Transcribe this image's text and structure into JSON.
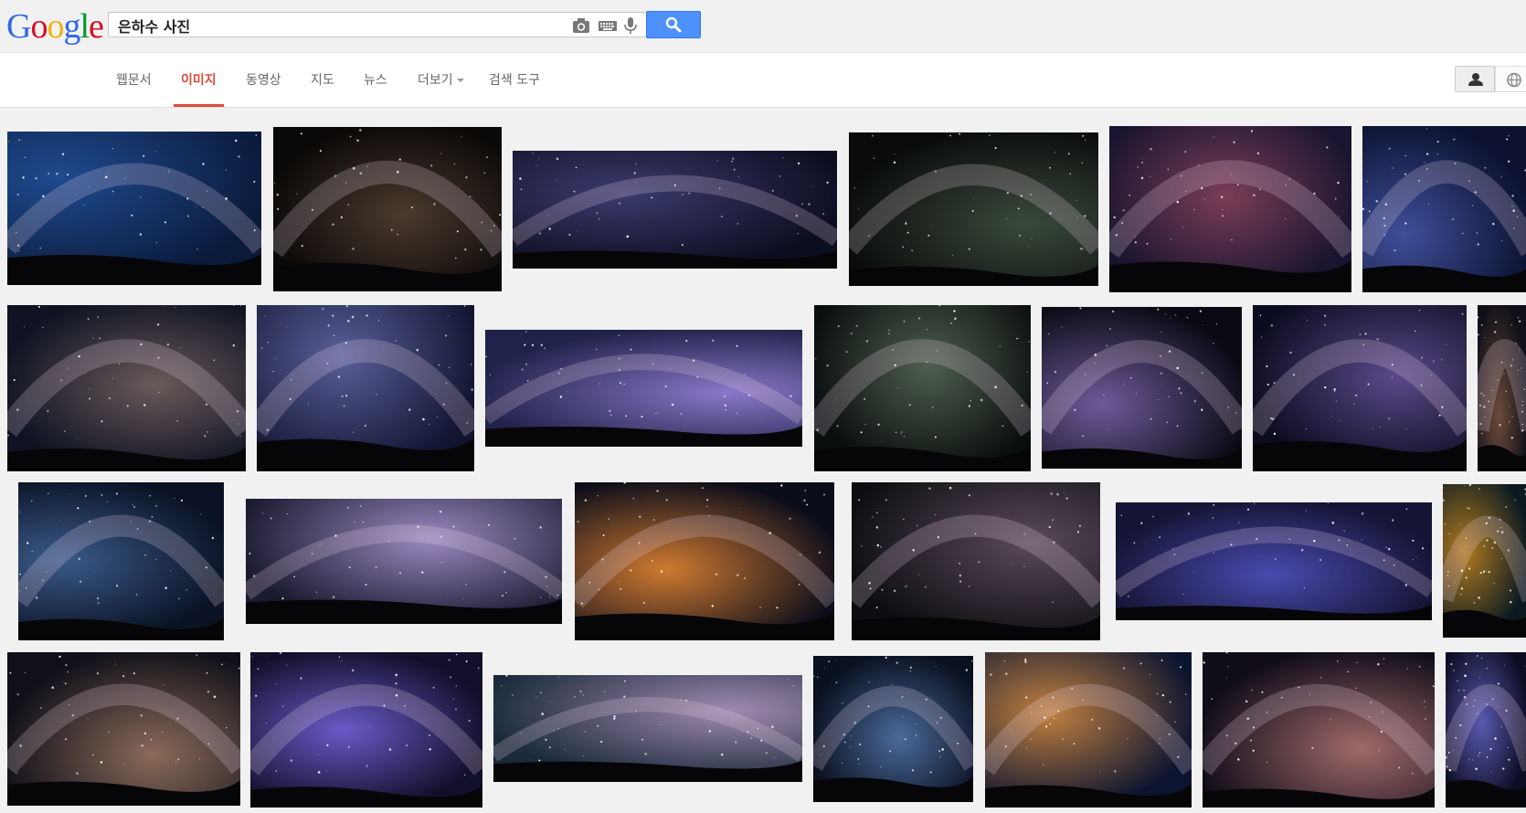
{
  "logo": {
    "letters": [
      "G",
      "o",
      "o",
      "g",
      "l",
      "e"
    ],
    "colors": [
      "#3369e8",
      "#d50f25",
      "#eeb211",
      "#3369e8",
      "#009925",
      "#d50f25"
    ]
  },
  "search": {
    "query": "은하수 사진",
    "accent": "#4d90fe"
  },
  "icons": {
    "camera": "camera-icon",
    "keyboard": "keyboard-icon",
    "mic": "microphone-icon",
    "search": "search-icon",
    "account": "person-icon",
    "globe": "globe-icon"
  },
  "nav": {
    "tabs": [
      {
        "label": "웹문서"
      },
      {
        "label": "이미지",
        "active": true
      },
      {
        "label": "동영상"
      },
      {
        "label": "지도"
      },
      {
        "label": "뉴스"
      },
      {
        "label": "더보기"
      },
      {
        "label": "검색 도구"
      }
    ],
    "active_color": "#dd4b39"
  },
  "results": {
    "rows": [
      {
        "count": 6
      },
      {
        "count": 7
      },
      {
        "count": 6
      },
      {
        "count": 7
      }
    ],
    "total_visible": 26
  }
}
